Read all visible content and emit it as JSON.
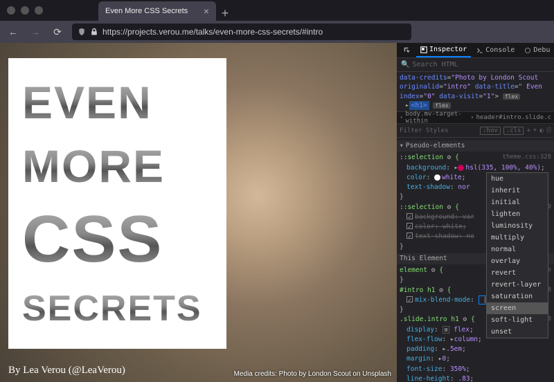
{
  "browser": {
    "tab_title": "Even More CSS Secrets",
    "url": "https://projects.verou.me/talks/even-more-css-secrets/#intro"
  },
  "page": {
    "word1": "EVEN",
    "word2": "MORE",
    "word3": "CSS",
    "word4": "SECRETS",
    "byline": "By Lea Verou (@LeaVerou)",
    "credits": "Media credits: Photo by London Scout on Unsplash"
  },
  "devtools": {
    "tabs": {
      "inspector": "Inspector",
      "console": "Console",
      "debugger": "Debu"
    },
    "search_placeholder": "Search HTML",
    "html": {
      "attr1": "data-credits=\"Photo by London Scout",
      "attr2": "originalid=\"intro\" data-title=\"  Even",
      "attr3": "index=\"0\" data-visit=\"1\">",
      "flex_pill": "flex",
      "h1_open": "<h1>",
      "h1_flex": "flex"
    },
    "crumbs": {
      "a": "body.mv-target-within",
      "b": "header#intro.slide.c"
    },
    "filter": {
      "placeholder": "Filter Styles",
      "hov": ":hov",
      "cls": ".cls"
    },
    "pseudo_header": "Pseudo-elements",
    "this_element": "This Element",
    "rules": {
      "sel0": "::selection",
      "src0": "theme.css:328",
      "p0a_n": "background",
      "p0a_v": "hsl(335, 100%, 40%)",
      "p0b_n": "color",
      "p0b_v": "white",
      "p0c_n": "text-shadow",
      "p0c_v": "nor",
      "sel1": "::selection",
      "src1": "s:100",
      "p1a": "background: var",
      "p1b": "color: white;",
      "p1c": "text-shadow: no",
      "sel2": "element",
      "src2": "nline",
      "sel3": "#intro h1",
      "src3": "ss:48",
      "p3a_n": "mix-blend-mode",
      "p3a_v": "",
      "sel4": ".slide.intro h1",
      "src4": "talk.css:30",
      "p4a_n": "display",
      "p4a_v": "flex",
      "p4b_n": "flex-flow",
      "p4b_v": "column",
      "p4c_n": "padding",
      "p4c_v": ".5em",
      "p4d_n": "margin",
      "p4d_v": "0",
      "p4e_n": "font-size",
      "p4e_v": "350%",
      "p4f_n": "line-height",
      "p4f_v": ".83"
    },
    "dropdown": [
      "hue",
      "inherit",
      "initial",
      "lighten",
      "luminosity",
      "multiply",
      "normal",
      "overlay",
      "revert",
      "revert-layer",
      "saturation",
      "screen",
      "soft-light",
      "unset"
    ],
    "dropdown_hl": "screen"
  }
}
